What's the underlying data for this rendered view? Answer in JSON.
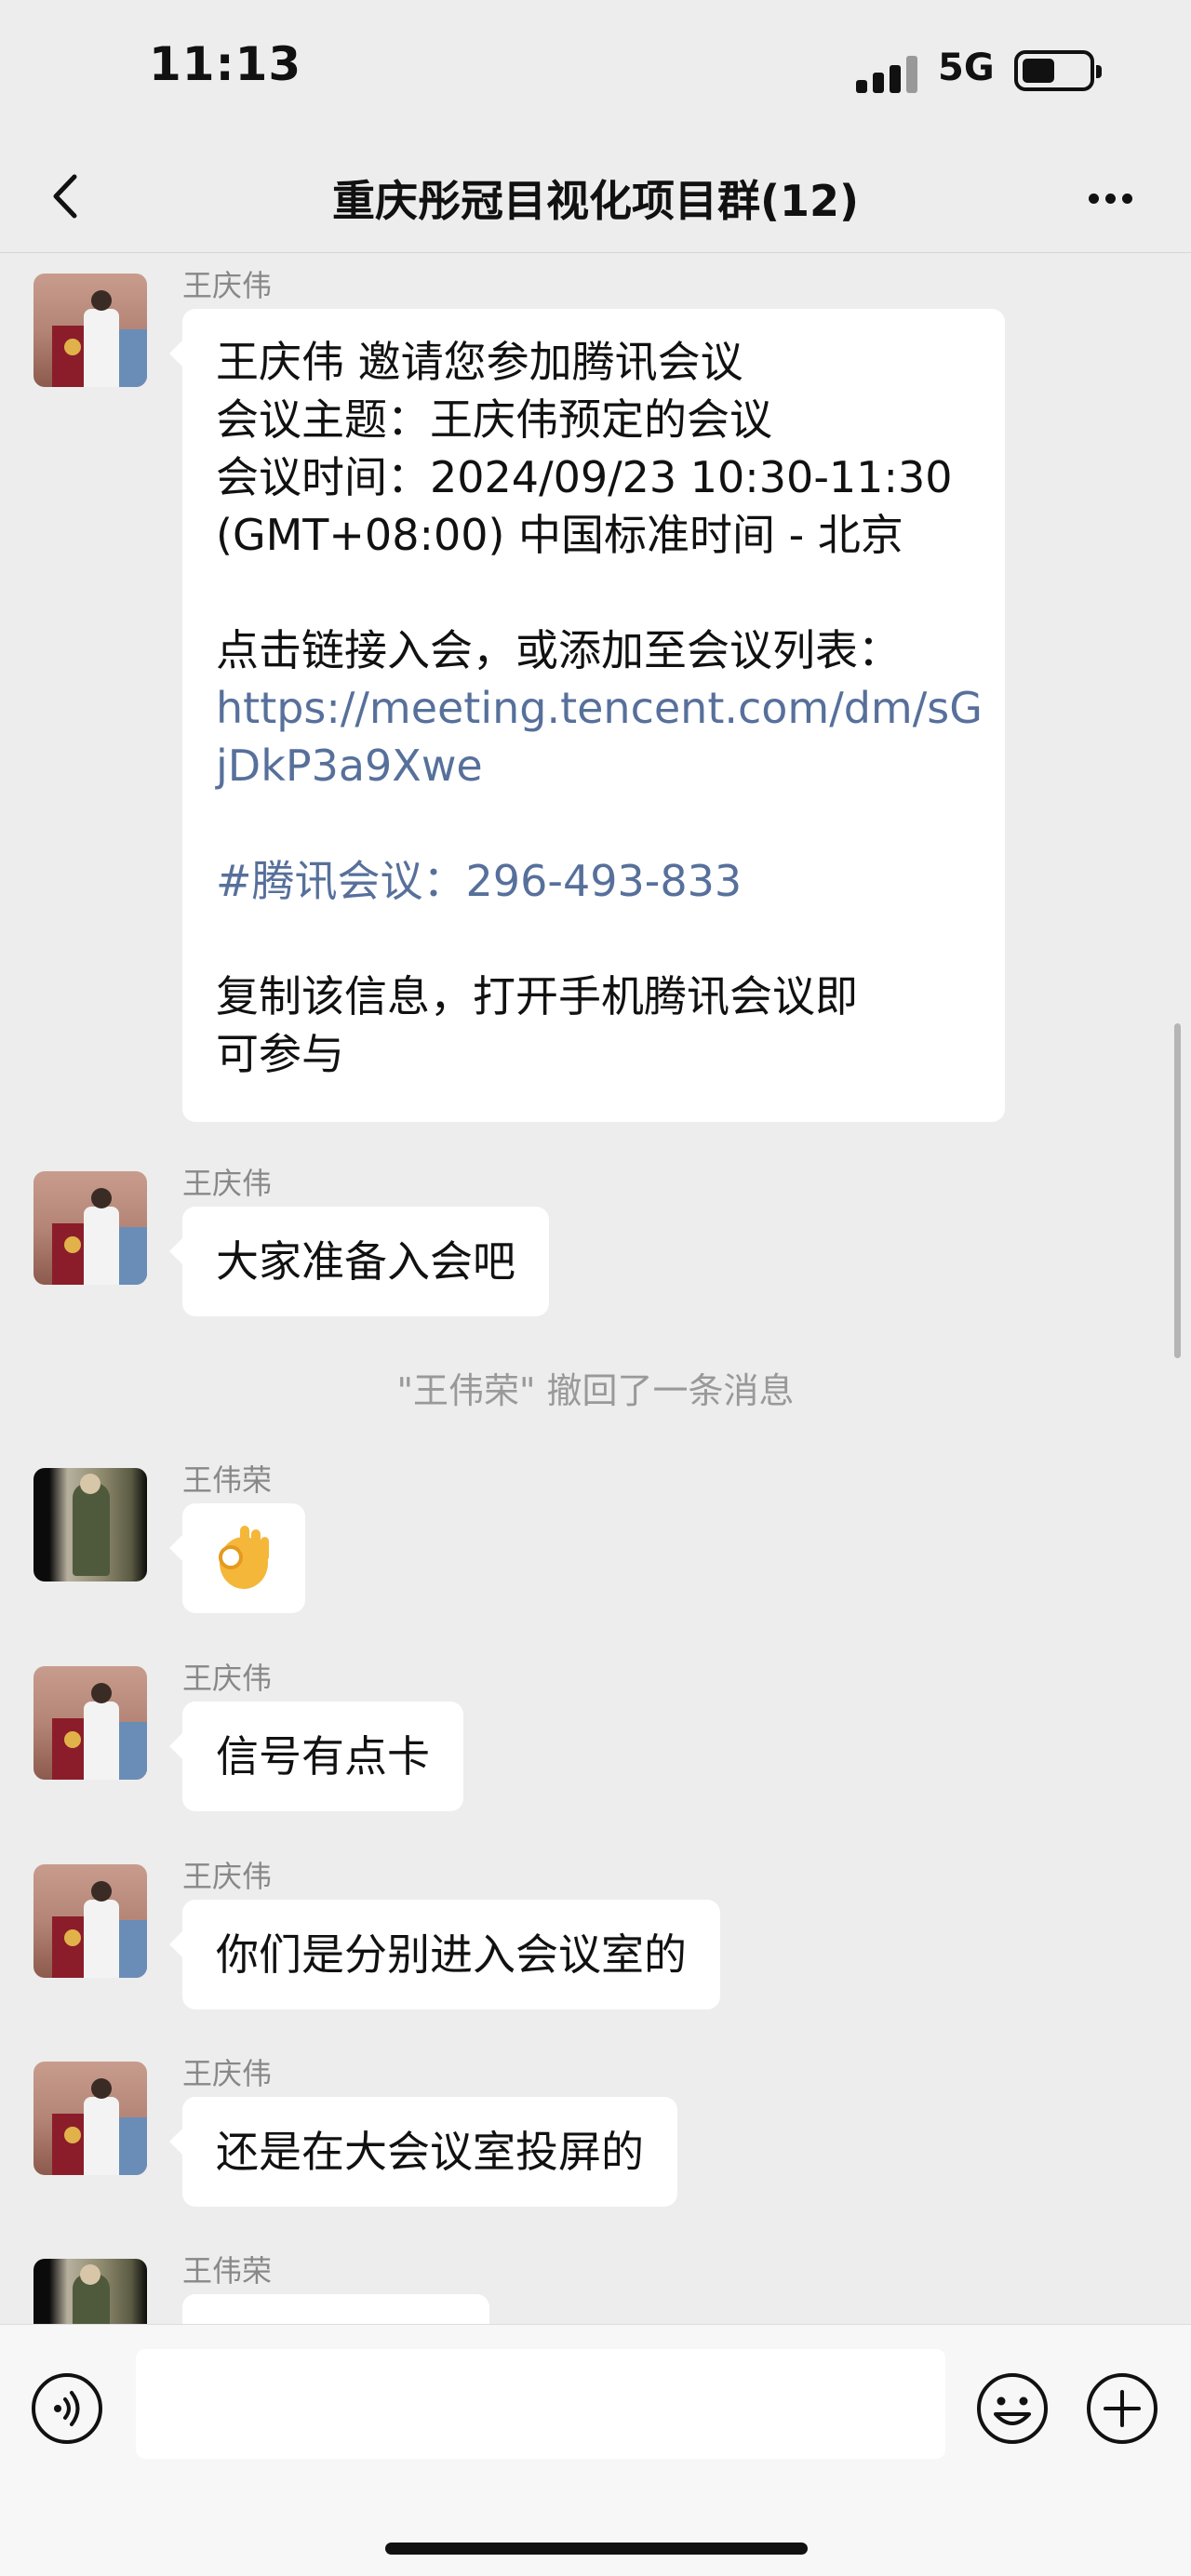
{
  "status_bar": {
    "time": "11:13",
    "network": "5G"
  },
  "nav": {
    "title": "重庆彤冠目视化项目群(12)",
    "back_icon": "chevron-left-icon",
    "more_icon": "more-horizontal-icon"
  },
  "messages": [
    {
      "sender": "王庆伟",
      "lines": [
        "王庆伟 邀请您参加腾讯会议",
        "会议主题：王庆伟预定的会议",
        "会议时间：2024/09/23 10:30-11:30",
        " (GMT+08:00) 中国标准时间 - 北京",
        "",
        "点击链接入会，或添加至会议列表：",
        "https://meeting.tencent.com/dm/sG",
        "jDkP3a9Xwe",
        "",
        "#腾讯会议：296-493-833",
        "",
        "复制该信息，打开手机腾讯会议即",
        "可参与"
      ]
    },
    {
      "sender": "王庆伟",
      "text": "大家准备入会吧"
    },
    {
      "system": "\"王伟荣\" 撤回了一条消息"
    },
    {
      "sender": "王伟荣",
      "emoji": "ok-hand-emoji"
    },
    {
      "sender": "王庆伟",
      "text": "信号有点卡"
    },
    {
      "sender": "王庆伟",
      "text": "你们是分别进入会议室的"
    },
    {
      "sender": "王庆伟",
      "text": "还是在大会议室投屏的"
    },
    {
      "sender": "王伟荣",
      "text": ""
    }
  ],
  "input_bar": {
    "voice_icon": "voice-icon",
    "placeholder": "",
    "emoji_icon": "smiley-icon",
    "plus_icon": "plus-circle-icon"
  },
  "colors": {
    "background": "#ededed",
    "bubble": "#ffffff",
    "link": "#57709b",
    "meta_text": "#888888"
  }
}
